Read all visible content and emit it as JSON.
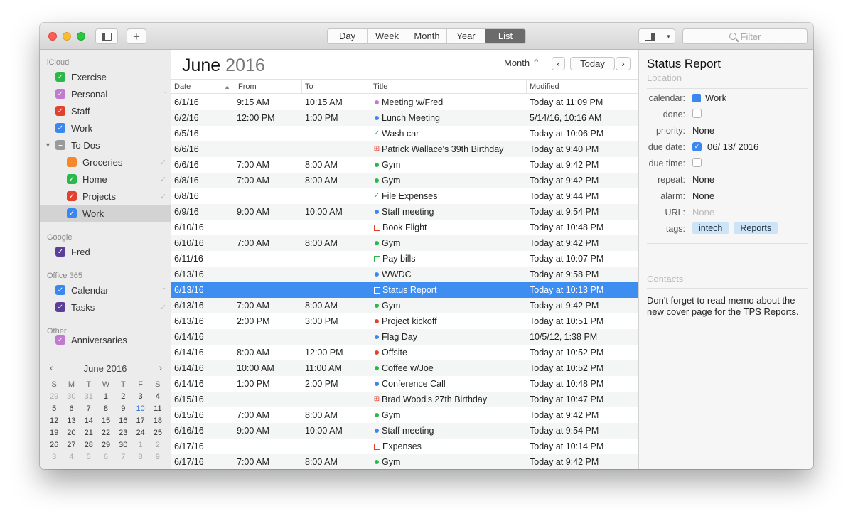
{
  "colors": {
    "selection": "#3d8ef0",
    "green": "#2bb84a",
    "blue": "#3a87f0",
    "red": "#e4402f",
    "purple": "#c27ad1",
    "orange": "#f5882b",
    "gray": "#9a9a9a",
    "dark_purple": "#5b3e9a"
  },
  "toolbar": {
    "views": [
      "Day",
      "Week",
      "Month",
      "Year",
      "List"
    ],
    "active_view": "List",
    "add_label": "+",
    "search_placeholder": "Filter"
  },
  "sidebar": {
    "groups": [
      {
        "name": "iCloud",
        "items": [
          {
            "label": "Exercise",
            "color": "#2bb84a",
            "icon": "check"
          },
          {
            "label": "Personal",
            "color": "#c27ad1",
            "icon": "check",
            "right_icon": "broadcast-icon"
          },
          {
            "label": "Staff",
            "color": "#e4402f",
            "icon": "check"
          },
          {
            "label": "Work",
            "color": "#3a87f0",
            "icon": "check"
          },
          {
            "label": "To Dos",
            "color": "#9a9a9a",
            "icon": "minus",
            "expanded": true
          },
          {
            "label": "Groceries",
            "color": "#f5882b",
            "icon": "none",
            "indent": true,
            "right_icon": "checkmark-icon"
          },
          {
            "label": "Home",
            "color": "#2bb84a",
            "icon": "check",
            "indent": true,
            "right_icon": "checkmark-icon"
          },
          {
            "label": "Projects",
            "color": "#e4402f",
            "icon": "check",
            "indent": true,
            "right_icon": "checkmark-icon"
          },
          {
            "label": "Work",
            "color": "#3a87f0",
            "icon": "check",
            "indent": true,
            "selected": true
          }
        ]
      },
      {
        "name": "Google",
        "items": [
          {
            "label": "Fred",
            "color": "#5b3e9a",
            "icon": "check"
          }
        ]
      },
      {
        "name": "Office 365",
        "items": [
          {
            "label": "Calendar",
            "color": "#3a87f0",
            "icon": "check",
            "right_icon": "broadcast-icon"
          },
          {
            "label": "Tasks",
            "color": "#5b3e9a",
            "icon": "check",
            "right_icon": "checkmark-icon"
          }
        ]
      },
      {
        "name": "Other",
        "items": [
          {
            "label": "Anniversaries",
            "color": "#c27ad1",
            "icon": "check"
          }
        ]
      }
    ]
  },
  "minical": {
    "title": "June 2016",
    "prev": "‹",
    "next": "›",
    "dow": [
      "S",
      "M",
      "T",
      "W",
      "T",
      "F",
      "S"
    ],
    "weeks": [
      [
        {
          "d": "29",
          "o": true
        },
        {
          "d": "30",
          "o": true
        },
        {
          "d": "31",
          "o": true
        },
        {
          "d": "1"
        },
        {
          "d": "2"
        },
        {
          "d": "3"
        },
        {
          "d": "4"
        }
      ],
      [
        {
          "d": "5"
        },
        {
          "d": "6"
        },
        {
          "d": "7"
        },
        {
          "d": "8"
        },
        {
          "d": "9"
        },
        {
          "d": "10",
          "t": true
        },
        {
          "d": "11"
        }
      ],
      [
        {
          "d": "12"
        },
        {
          "d": "13"
        },
        {
          "d": "14"
        },
        {
          "d": "15"
        },
        {
          "d": "16"
        },
        {
          "d": "17"
        },
        {
          "d": "18"
        }
      ],
      [
        {
          "d": "19"
        },
        {
          "d": "20"
        },
        {
          "d": "21"
        },
        {
          "d": "22"
        },
        {
          "d": "23"
        },
        {
          "d": "24"
        },
        {
          "d": "25"
        }
      ],
      [
        {
          "d": "26"
        },
        {
          "d": "27"
        },
        {
          "d": "28"
        },
        {
          "d": "29"
        },
        {
          "d": "30"
        },
        {
          "d": "1",
          "o": true
        },
        {
          "d": "2",
          "o": true
        }
      ],
      [
        {
          "d": "3",
          "o": true
        },
        {
          "d": "4",
          "o": true
        },
        {
          "d": "5",
          "o": true
        },
        {
          "d": "6",
          "o": true
        },
        {
          "d": "7",
          "o": true
        },
        {
          "d": "8",
          "o": true
        },
        {
          "d": "9",
          "o": true
        }
      ]
    ]
  },
  "main": {
    "month": "June",
    "year": "2016",
    "range_label": "Month ⌃",
    "prev": "‹",
    "today": "Today",
    "next": "›",
    "columns": [
      "Date",
      "From",
      "To",
      "Title",
      "Modified"
    ],
    "rows": [
      {
        "date": "6/1/16",
        "from": "9:15 AM",
        "to": "10:15 AM",
        "title": "Meeting w/Fred",
        "modified": "Today at 11:09 PM",
        "mark": "dot",
        "color": "#c27ad1"
      },
      {
        "date": "6/2/16",
        "from": "12:00 PM",
        "to": "1:00 PM",
        "title": "Lunch Meeting",
        "modified": "5/14/16, 10:16 AM",
        "mark": "dot",
        "color": "#3a87f0"
      },
      {
        "date": "6/5/16",
        "from": "",
        "to": "",
        "title": "Wash car",
        "modified": "Today at 10:06 PM",
        "mark": "check",
        "color": "#2bb84a"
      },
      {
        "date": "6/6/16",
        "from": "",
        "to": "",
        "title": "Patrick Wallace's 39th Birthday",
        "modified": "Today at 9:40 PM",
        "mark": "gift",
        "color": "#e4402f"
      },
      {
        "date": "6/6/16",
        "from": "7:00 AM",
        "to": "8:00 AM",
        "title": "Gym",
        "modified": "Today at 9:42 PM",
        "mark": "dot",
        "color": "#2bb84a"
      },
      {
        "date": "6/8/16",
        "from": "7:00 AM",
        "to": "8:00 AM",
        "title": "Gym",
        "modified": "Today at 9:42 PM",
        "mark": "dot",
        "color": "#2bb84a"
      },
      {
        "date": "6/8/16",
        "from": "",
        "to": "",
        "title": "File Expenses",
        "modified": "Today at 9:44 PM",
        "mark": "check",
        "color": "#3a87f0"
      },
      {
        "date": "6/9/16",
        "from": "9:00 AM",
        "to": "10:00 AM",
        "title": "Staff meeting",
        "modified": "Today at 9:54 PM",
        "mark": "dot",
        "color": "#3a87f0"
      },
      {
        "date": "6/10/16",
        "from": "",
        "to": "",
        "title": "Book Flight",
        "modified": "Today at 10:48 PM",
        "mark": "box",
        "color": "#e4402f"
      },
      {
        "date": "6/10/16",
        "from": "7:00 AM",
        "to": "8:00 AM",
        "title": "Gym",
        "modified": "Today at 9:42 PM",
        "mark": "dot",
        "color": "#2bb84a"
      },
      {
        "date": "6/11/16",
        "from": "",
        "to": "",
        "title": "Pay bills",
        "modified": "Today at 10:07 PM",
        "mark": "box",
        "color": "#2bb84a"
      },
      {
        "date": "6/13/16",
        "from": "",
        "to": "",
        "title": "WWDC",
        "modified": "Today at 9:58 PM",
        "mark": "dot",
        "color": "#3a87f0"
      },
      {
        "date": "6/13/16",
        "from": "",
        "to": "",
        "title": "Status Report",
        "modified": "Today at 10:13 PM",
        "mark": "box",
        "color": "#ffffff",
        "selected": true
      },
      {
        "date": "6/13/16",
        "from": "7:00 AM",
        "to": "8:00 AM",
        "title": "Gym",
        "modified": "Today at 9:42 PM",
        "mark": "dot",
        "color": "#2bb84a"
      },
      {
        "date": "6/13/16",
        "from": "2:00 PM",
        "to": "3:00 PM",
        "title": "Project kickoff",
        "modified": "Today at 10:51 PM",
        "mark": "dot",
        "color": "#e4402f"
      },
      {
        "date": "6/14/16",
        "from": "",
        "to": "",
        "title": "Flag Day",
        "modified": "10/5/12, 1:38 PM",
        "mark": "dot",
        "color": "#3a87f0"
      },
      {
        "date": "6/14/16",
        "from": "8:00 AM",
        "to": "12:00 PM",
        "title": "Offsite",
        "modified": "Today at 10:52 PM",
        "mark": "dot",
        "color": "#e4402f"
      },
      {
        "date": "6/14/16",
        "from": "10:00 AM",
        "to": "11:00 AM",
        "title": "Coffee w/Joe",
        "modified": "Today at 10:52 PM",
        "mark": "dot",
        "color": "#2bb84a"
      },
      {
        "date": "6/14/16",
        "from": "1:00 PM",
        "to": "2:00 PM",
        "title": "Conference Call",
        "modified": "Today at 10:48 PM",
        "mark": "dot",
        "color": "#3a87f0"
      },
      {
        "date": "6/15/16",
        "from": "",
        "to": "",
        "title": "Brad Wood's 27th Birthday",
        "modified": "Today at 10:47 PM",
        "mark": "gift",
        "color": "#e4402f"
      },
      {
        "date": "6/15/16",
        "from": "7:00 AM",
        "to": "8:00 AM",
        "title": "Gym",
        "modified": "Today at 9:42 PM",
        "mark": "dot",
        "color": "#2bb84a"
      },
      {
        "date": "6/16/16",
        "from": "9:00 AM",
        "to": "10:00 AM",
        "title": "Staff meeting",
        "modified": "Today at 9:54 PM",
        "mark": "dot",
        "color": "#3a87f0"
      },
      {
        "date": "6/17/16",
        "from": "",
        "to": "",
        "title": "Expenses",
        "modified": "Today at 10:14 PM",
        "mark": "box",
        "color": "#e4402f"
      },
      {
        "date": "6/17/16",
        "from": "7:00 AM",
        "to": "8:00 AM",
        "title": "Gym",
        "modified": "Today at 9:42 PM",
        "mark": "dot",
        "color": "#2bb84a"
      }
    ]
  },
  "inspector": {
    "title": "Status Report",
    "location_placeholder": "Location",
    "fields": {
      "calendar_label": "calendar:",
      "calendar_value": "Work",
      "done_label": "done:",
      "priority_label": "priority:",
      "priority_value": "None",
      "due_date_label": "due date:",
      "due_date_value": "06/ 13/ 2016",
      "due_time_label": "due time:",
      "repeat_label": "repeat:",
      "repeat_value": "None",
      "alarm_label": "alarm:",
      "alarm_value": "None",
      "url_label": "URL:",
      "url_value": "None",
      "tags_label": "tags:"
    },
    "tags": [
      "intech",
      "Reports"
    ],
    "contacts_label": "Contacts",
    "notes": "Don't forget to read memo about the new cover page for the TPS Reports."
  }
}
